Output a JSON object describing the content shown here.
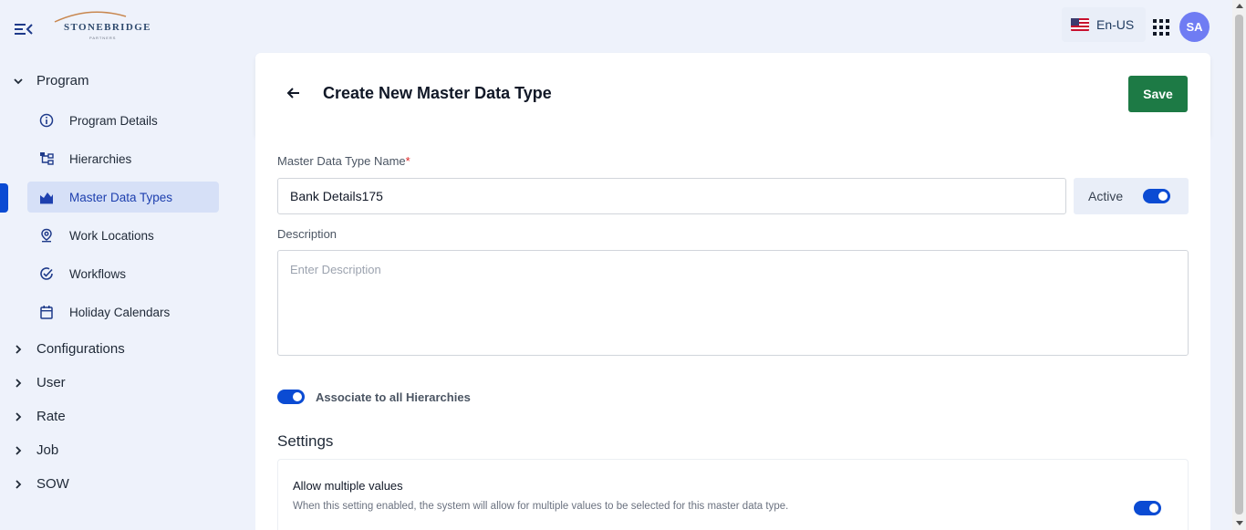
{
  "header": {
    "logo_text": "STONEBRIDGE",
    "logo_subtext": "PARTNERS",
    "language": "En-US",
    "avatar_initials": "SA"
  },
  "sidebar": {
    "program_label": "Program",
    "program_items": [
      {
        "label": "Program Details",
        "icon": "info-icon"
      },
      {
        "label": "Hierarchies",
        "icon": "hierarchy-icon"
      },
      {
        "label": "Master Data Types",
        "icon": "chart-icon",
        "active": true
      },
      {
        "label": "Work Locations",
        "icon": "location-pin-icon"
      },
      {
        "label": "Workflows",
        "icon": "check-circle-icon"
      },
      {
        "label": "Holiday Calendars",
        "icon": "calendar-icon"
      }
    ],
    "sections": [
      "Configurations",
      "User",
      "Rate",
      "Job",
      "SOW"
    ]
  },
  "page": {
    "title": "Create New Master Data Type",
    "save_label": "Save"
  },
  "form": {
    "name_label": "Master Data Type Name",
    "name_required_mark": "*",
    "name_value": "Bank Details175",
    "active_label": "Active",
    "active_on": true,
    "description_label": "Description",
    "description_placeholder": "Enter Description",
    "description_value": "",
    "associate_label": "Associate to all Hierarchies",
    "associate_on": true
  },
  "settings": {
    "title": "Settings",
    "items": [
      {
        "name": "Allow multiple values",
        "description": "When this setting enabled, the system will allow for multiple values to be selected for this master data type.",
        "on": true
      }
    ]
  },
  "colors": {
    "primary": "#0b4bd3",
    "save": "#1d7a45",
    "avatar": "#6f7cf3",
    "background": "#eef2fb"
  }
}
